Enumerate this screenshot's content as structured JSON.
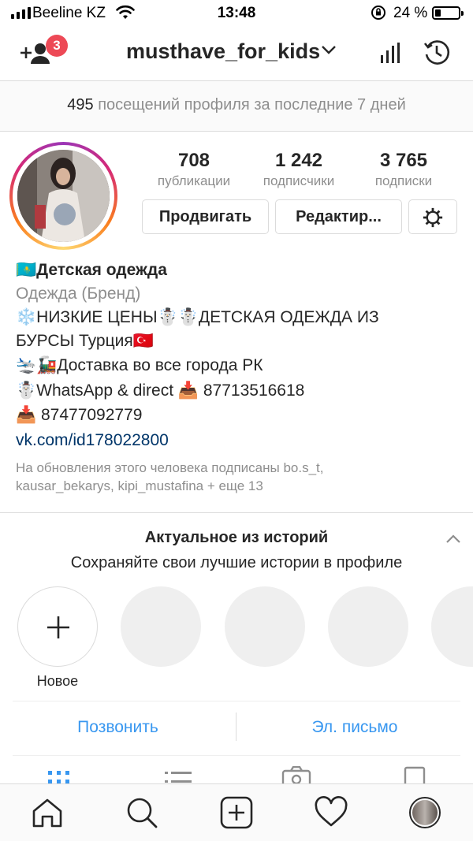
{
  "status_bar": {
    "carrier": "Beeline KZ",
    "time": "13:48",
    "battery_percent": "24 %",
    "battery_level": 0.24
  },
  "header": {
    "username": "musthave_for_kids",
    "notification_count": "3"
  },
  "visits_banner": {
    "count": "495",
    "text": "посещений профиля за последние 7 дней"
  },
  "profile": {
    "stats": [
      {
        "value": "708",
        "label": "публикации"
      },
      {
        "value": "1 242",
        "label": "подписчики"
      },
      {
        "value": "3 765",
        "label": "подписки"
      }
    ],
    "promote_button": "Продвигать",
    "edit_button": "Редактир...",
    "name": "🇰🇿Детская одежда",
    "category": "Одежда (Бренд)",
    "bio_lines": [
      "❄️НИЗКИЕ ЦЕНЫ☃️☃️ДЕТСКАЯ ОДЕЖДА ИЗ",
      "БУРСЫ Турция🇹🇷",
      "🛬🚂Доставка во все города РК",
      "☃️WhatsApp & direct 📥 87713516618",
      "📥 87477092779"
    ],
    "link": "vk.com/id178022800",
    "followed_by": [
      "На обновления этого человека подписаны bo.s_t,",
      "kausar_bekarys, kipi_mustafina + еще 13"
    ]
  },
  "highlights": {
    "title": "Актуальное из историй",
    "subtitle": "Сохраняйте свои лучшие истории в профиле",
    "new_label": "Новое"
  },
  "contact": {
    "call": "Позвонить",
    "email": "Эл. письмо"
  },
  "colors": {
    "link_blue": "#3897f0",
    "badge_red": "#ed4956",
    "text_primary": "#262626",
    "text_secondary": "#8e8e8e"
  },
  "icons": {
    "add_user": "add-user-icon",
    "stats": "bar-chart-icon",
    "history": "history-icon",
    "settings": "gear-icon",
    "bottom_nav": [
      "home-icon",
      "search-icon",
      "add-post-icon",
      "heart-icon",
      "profile-avatar"
    ]
  }
}
